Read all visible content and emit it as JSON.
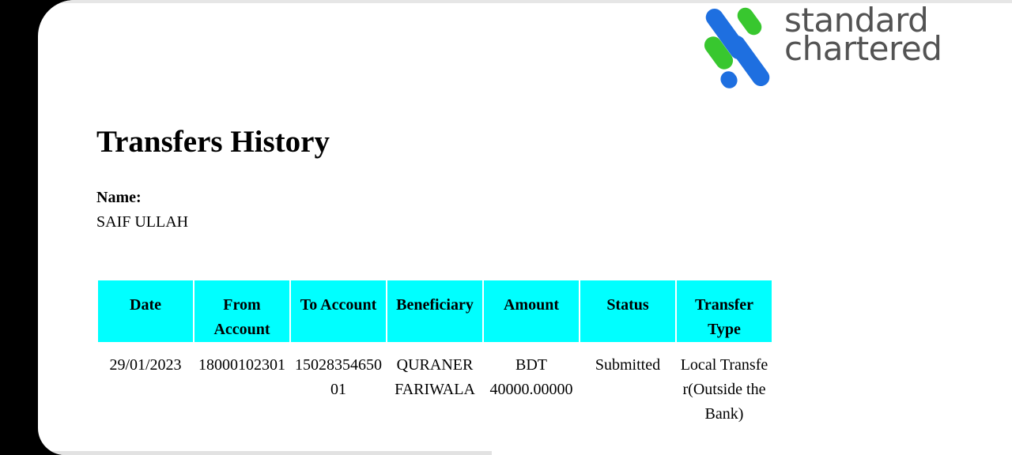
{
  "brand": {
    "logo_line1": "standard",
    "logo_line2": "chartered",
    "colors": {
      "blue": "#1e6fe0",
      "green": "#38c72f",
      "accent": "#00ffff"
    }
  },
  "document": {
    "title": "Transfers History",
    "name_label": "Name:",
    "name_value": "SAIF ULLAH"
  },
  "table": {
    "headers": [
      "Date",
      "From Account",
      "To Account",
      "Beneficiary",
      "Amount",
      "Status",
      "Transfer Type"
    ],
    "rows": [
      [
        "29/01/2023",
        "18000102301",
        "1502835465001",
        "QURANER FARIWALA",
        "BDT 40000.00000",
        "Submitted",
        "Local Transfer(Outside the Bank)"
      ]
    ]
  }
}
